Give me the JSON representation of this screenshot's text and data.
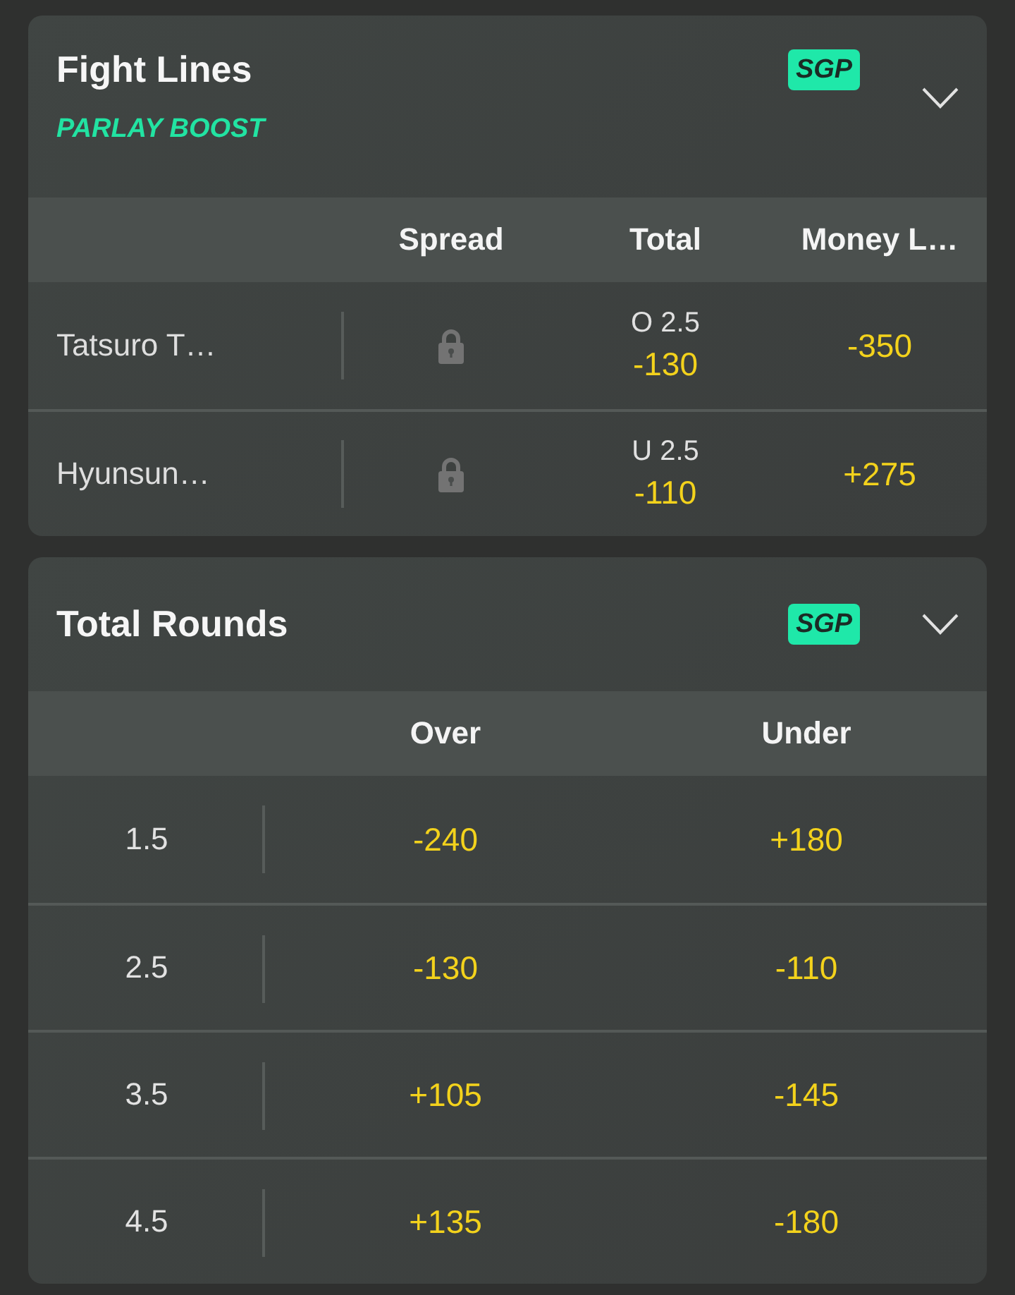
{
  "markets": [
    {
      "kind": "fighters",
      "title": "Fight Lines",
      "promo": "PARLAY BOOST",
      "badge": "SGP",
      "expanded": true,
      "columns": [
        "Spread",
        "Total",
        "Money L…"
      ],
      "rows": [
        {
          "name": "Tatsuro T…",
          "spread_locked": true,
          "total_line": "O 2.5",
          "total_odds": "-130",
          "moneyline": "-350"
        },
        {
          "name": "Hyunsun…",
          "spread_locked": true,
          "total_line": "U 2.5",
          "total_odds": "-110",
          "moneyline": "+275"
        }
      ]
    },
    {
      "kind": "rounds",
      "title": "Total Rounds",
      "badge": "SGP",
      "expanded": true,
      "columns": [
        "Over",
        "Under"
      ],
      "rows": [
        {
          "line": "1.5",
          "over": "-240",
          "under": "+180"
        },
        {
          "line": "2.5",
          "over": "-130",
          "under": "-110"
        },
        {
          "line": "3.5",
          "over": "+105",
          "under": "-145"
        },
        {
          "line": "4.5",
          "over": "+135",
          "under": "-180"
        }
      ]
    }
  ]
}
